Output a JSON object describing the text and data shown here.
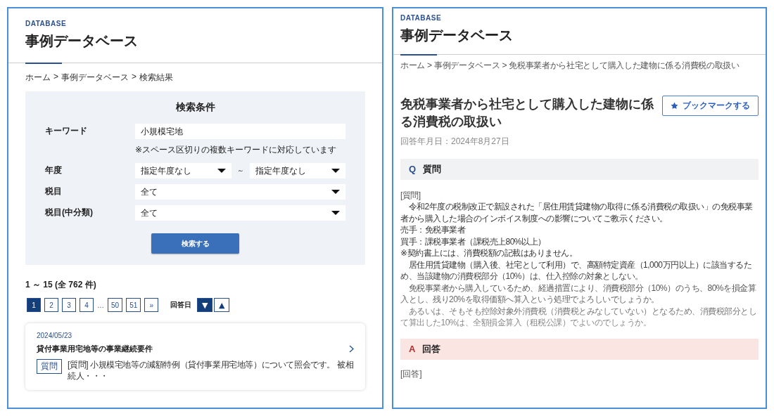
{
  "left": {
    "brand": "DATABASE",
    "title": "事例データベース",
    "breadcrumb_separator": ">",
    "breadcrumb": [
      "ホーム",
      "事例データベース",
      "検索結果"
    ],
    "search": {
      "title": "検索条件",
      "fields": [
        {
          "kind": "text",
          "label": "キーワード",
          "value": "小規模宅地",
          "note": "※スペース区切りの複数キーワードに対応しています"
        },
        {
          "kind": "range",
          "label": "年度",
          "from": "指定年度なし",
          "separator": "～",
          "to": "指定年度なし"
        },
        {
          "kind": "select",
          "label": "税目",
          "value": "全て"
        },
        {
          "kind": "select",
          "label": "税目(中分類)",
          "value": "全て"
        }
      ],
      "button": "検索する"
    },
    "result_count": "1 ～ 15 (全 762 件)",
    "pagination": [
      {
        "kind": "page",
        "label": "1",
        "selected": true
      },
      {
        "kind": "page",
        "label": "2",
        "selected": false
      },
      {
        "kind": "page",
        "label": "3",
        "selected": false
      },
      {
        "kind": "page",
        "label": "4",
        "selected": false
      },
      {
        "kind": "gap",
        "label": "…"
      },
      {
        "kind": "page",
        "label": "50",
        "selected": false
      },
      {
        "kind": "page",
        "label": "51",
        "selected": false
      },
      {
        "kind": "page",
        "label": "»",
        "selected": false
      }
    ],
    "sort": {
      "label": "回答日",
      "buttons": [
        {
          "symbol": "▼",
          "selected": true
        },
        {
          "symbol": "▲",
          "selected": false
        }
      ]
    },
    "results": [
      {
        "date": "2024/05/23",
        "title": "貸付事業用宅地等の事業継続要件",
        "tag": "質問",
        "snippet": "[質問] 小規模宅地等の減額特例（貸付事業用宅地等）について照会です。 被相続人・・・"
      }
    ]
  },
  "right": {
    "brand": "DATABASE",
    "title": "事例データベース",
    "breadcrumb_separator": ">",
    "breadcrumb": [
      "ホーム",
      "事例データベース",
      "免税事業者から社宅として購入した建物に係る消費税の取扱い"
    ],
    "bookmark_button": "ブックマークする",
    "article": {
      "title": "免税事業者から社宅として購入した建物に係る消費税の取扱い",
      "answer_date": "回答年月日：2024年8月27日",
      "question": {
        "marker": "Q",
        "heading": "質問",
        "label": "[質問]",
        "faded": true,
        "paragraphs": [
          "　令和2年度の税制改正で新設された「居住用賃貸建物の取得に係る消費税の取扱い」の免税事業者から購入した場合のインボイス制度への影響についてご教示ください。",
          "売手：免税事業者",
          "買手：課税事業者（課税売上80%以上）",
          "※契約書上には、消費税額の記載はありません。",
          "　居住用賃貸建物（購入後、社宅として利用）で、高額特定資産（1,000万円以上）に該当するため、当該建物の消費税部分（10%）は、仕入控除の対象としない。",
          "　免税事業者から購入しているため、経過措置により、消費税部分（10%）のうち、80%を損金算入とし、残り20%を取得価額へ算入という処理でよろしいでしょうか。",
          "　あるいは、そもそも控除対象外消費税（消費税とみなしていない）となるため、消費税部分として算出した10%は、全額損金算入（租税公課）でよいのでしょうか。"
        ]
      },
      "answer": {
        "marker": "A",
        "heading": "回答",
        "label": "[回答]"
      }
    }
  }
}
